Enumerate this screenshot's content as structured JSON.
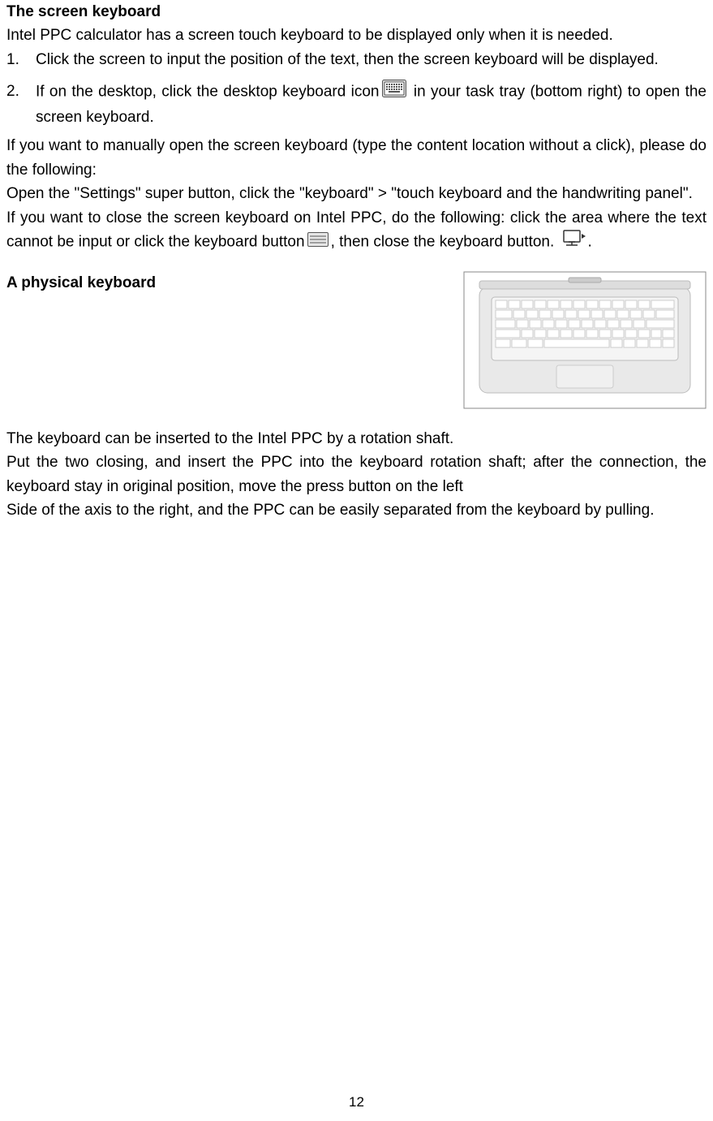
{
  "headings": {
    "screen_kbd": "The screen keyboard",
    "physical_kbd": "A physical keyboard"
  },
  "intro": "Intel PPC calculator has a screen touch keyboard to be displayed only when it is needed.",
  "list": {
    "n1": "1.",
    "t1": "Click the screen to input the position of the text, then the screen keyboard will be displayed.",
    "n2": "2.",
    "t2a": "If on the desktop, click the desktop keyboard icon",
    "t2b": " in your task tray (bottom right) to open the screen keyboard."
  },
  "manual_open1": "If you want to manually open the screen keyboard (type the content location without a click), please do the following:",
  "manual_open2": "Open the \"Settings\" super button, click the \"keyboard\" > \"touch keyboard and the handwriting panel\".",
  "close1a": "If you want to close the screen keyboard on Intel PPC, do the following: click the area where the text cannot be input or click the keyboard button",
  "close1b": ", then close the keyboard button. ",
  "close1c": ".",
  "phys1": "The keyboard can be inserted to the Intel PPC by a rotation shaft.",
  "phys2": "Put the two closing, and insert the PPC into the keyboard rotation shaft; after the connection, the keyboard stay in original position, move the press button on the left",
  "phys3": "Side of the axis to the right, and the PPC can be easily separated from the keyboard by pulling.",
  "page_number": "12"
}
